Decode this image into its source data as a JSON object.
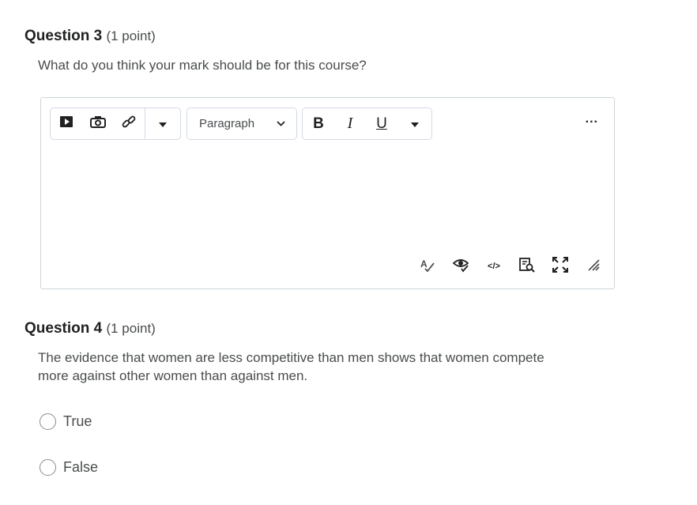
{
  "questions": [
    {
      "name": "Question 3",
      "points": "(1 point)",
      "text": "What do you think your mark should be for this course?"
    },
    {
      "name": "Question 4",
      "points": "(1 point)",
      "text": "The evidence that women are less competitive than men shows that women compete more against other women than against men.",
      "options": [
        "True",
        "False"
      ]
    }
  ],
  "editor": {
    "toolbar": {
      "insert_icons": [
        "video-icon",
        "camera-icon",
        "link-icon",
        "dropdown-caret-icon"
      ],
      "format_select": "Paragraph",
      "bold": "B",
      "italic": "I",
      "underline": "U",
      "more": "..."
    },
    "bottom_tools": [
      "spellcheck-icon",
      "accessibility-check-icon",
      "source-code-icon",
      "preview-icon",
      "fullscreen-icon",
      "resize-handle-icon"
    ],
    "source_code_label": "</>",
    "colors": {
      "border": "#cdd5dc",
      "toolbar_border": "#d3d9e3"
    }
  }
}
